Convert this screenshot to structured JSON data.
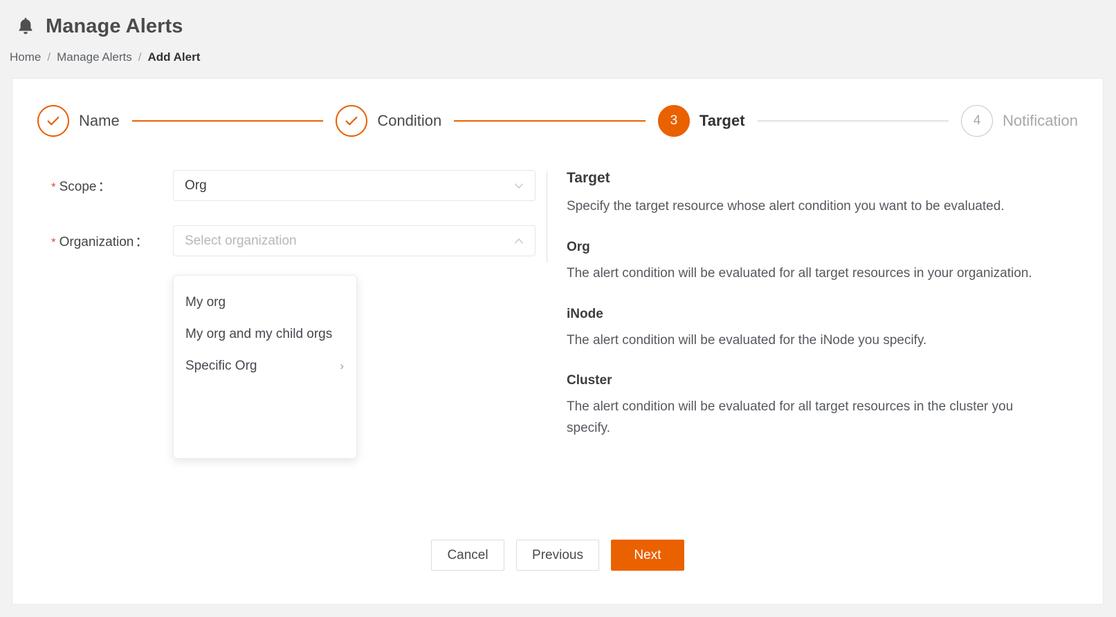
{
  "header": {
    "icon": "bell-icon",
    "title": "Manage Alerts"
  },
  "breadcrumb": {
    "items": [
      {
        "label": "Home",
        "current": false
      },
      {
        "label": "Manage Alerts",
        "current": false
      },
      {
        "label": "Add Alert",
        "current": true
      }
    ],
    "separator": "/"
  },
  "stepper": {
    "steps": [
      {
        "number": "1",
        "label": "Name",
        "state": "done",
        "icon": "check-icon"
      },
      {
        "number": "2",
        "label": "Condition",
        "state": "done",
        "icon": "check-icon"
      },
      {
        "number": "3",
        "label": "Target",
        "state": "active"
      },
      {
        "number": "4",
        "label": "Notification",
        "state": "todo"
      }
    ]
  },
  "form": {
    "scope": {
      "label": "Scope",
      "required_marker": "*",
      "colon": "：",
      "value": "Org",
      "chevron": "chevron-down-icon"
    },
    "organization": {
      "label": "Organization",
      "required_marker": "*",
      "colon": "：",
      "value": "",
      "placeholder": "Select organization",
      "chevron": "chevron-up-icon"
    }
  },
  "dropdown": {
    "open": true,
    "options": [
      {
        "label": "My org",
        "has_submenu": false
      },
      {
        "label": "My org and my child orgs",
        "has_submenu": false
      },
      {
        "label": "Specific Org",
        "has_submenu": true,
        "submenu_arrow": "›"
      }
    ]
  },
  "help": {
    "title": "Target",
    "intro": "Specify the target resource whose alert condition you want to be evaluated.",
    "sections": [
      {
        "heading": "Org",
        "text": "The alert condition will be evaluated for all target resources in your organization."
      },
      {
        "heading": "iNode",
        "text": "The alert condition will be evaluated for the iNode you specify."
      },
      {
        "heading": "Cluster",
        "text": "The alert condition will be evaluated for all target resources in the cluster you specify."
      }
    ]
  },
  "footer": {
    "cancel_label": "Cancel",
    "previous_label": "Previous",
    "next_label": "Next"
  },
  "colors": {
    "accent": "#ea6100",
    "page_background": "#f2f2f2",
    "required_star": "#e8453c",
    "muted_text": "#a8a8a8"
  }
}
